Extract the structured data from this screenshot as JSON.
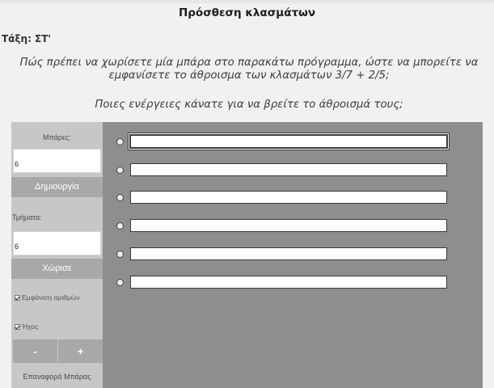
{
  "page": {
    "title": "Πρόσθεση κλασμάτων",
    "grade": "Τάξη: ΣΤ'",
    "question_line1": "Πώς πρέπει να χωρίσετε μία μπάρα στο παρακάτω πρόγραμμα, ώστε να μπορείτε να",
    "question_line2": "εμφανίσετε το άθροισμα των κλασμάτων 3/7 + 2/5;",
    "question2": "Ποιες ενέργειες κάνατε για να βρείτε το άθροισμά τους;"
  },
  "controls": {
    "bars_label": "Μπάρες:",
    "bars_value": "6",
    "create_button": "Δημιουργία",
    "parts_label": "Τμήματα:",
    "parts_value": "6",
    "split_button": "Χώρισε",
    "show_numbers_label": "Εμφάνιση αριθμών",
    "sound_label": "Ήχος",
    "minus_button": "-",
    "plus_button": "+",
    "reset_bar_button": "Επαναφορά Μπάρας"
  },
  "answers": [
    "",
    "",
    "",
    "",
    "",
    ""
  ],
  "colors": {
    "page_bg": "#f1f1f1",
    "panel_bg": "#8e8e8e",
    "sidebar_bg": "#c7c7c7",
    "button_bg": "#a8a8a8"
  }
}
